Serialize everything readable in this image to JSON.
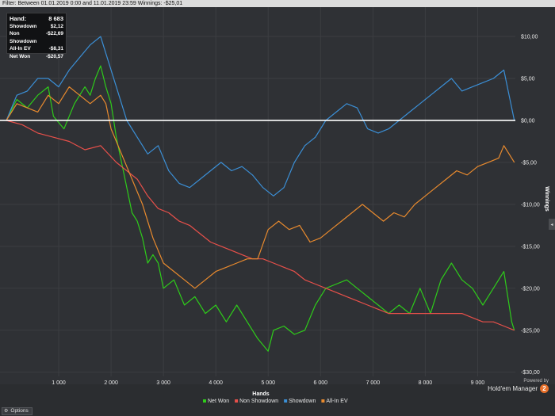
{
  "filter_bar": {
    "text": "Filter: Between 01.01.2019 0:00 and 11.01.2019 23:59 Winnings: -$25,01"
  },
  "stats": [
    {
      "label": "Hand:",
      "value": "8 683"
    },
    {
      "label": "Showdown",
      "value": "$2,12"
    },
    {
      "label": "Non Showdown",
      "value": "-$22,69"
    },
    {
      "label": "All-In EV",
      "value": "-$8,31"
    },
    {
      "label": "Net Won",
      "value": "-$20,57"
    }
  ],
  "options_label": "Options",
  "branding": {
    "powered": "Powered by",
    "product": "Hold'em Manager",
    "badge": "2"
  },
  "colors": {
    "net_won": "#2ecc1a",
    "non_showdown": "#e8504a",
    "showdown": "#3b8fd6",
    "all_in_ev": "#e88a2e",
    "zero_line": "#ffffff",
    "grid": "#3c3e42"
  },
  "chart_data": {
    "type": "line",
    "xlabel": "Hands",
    "ylabel": "Winnings",
    "xlim": [
      0,
      9720
    ],
    "ylim": [
      -30.5,
      13.5
    ],
    "x_ticks": [
      1000,
      2000,
      3000,
      4000,
      5000,
      6000,
      7000,
      8000,
      9000
    ],
    "x_tick_labels": [
      "1 000",
      "2 000",
      "3 000",
      "4 000",
      "5 000",
      "6 000",
      "7 000",
      "8 000",
      "9 000"
    ],
    "y_ticks": [
      10,
      5,
      0,
      -5,
      -10,
      -15,
      -20,
      -25,
      -30
    ],
    "y_tick_labels": [
      "$10,00",
      "$5,00",
      "$0,00",
      "-$5,00",
      "-$10,00",
      "-$15,00",
      "-$20,00",
      "-$25,00",
      "-$30,00"
    ],
    "legend_position": "bottom-center",
    "series": [
      {
        "name": "Net Won",
        "color_key": "net_won",
        "points": [
          [
            0,
            0
          ],
          [
            200,
            2.5
          ],
          [
            400,
            1.5
          ],
          [
            600,
            3
          ],
          [
            800,
            4
          ],
          [
            900,
            0.5
          ],
          [
            1100,
            -1
          ],
          [
            1300,
            2
          ],
          [
            1500,
            4
          ],
          [
            1600,
            3
          ],
          [
            1700,
            5
          ],
          [
            1800,
            6.5
          ],
          [
            1900,
            4
          ],
          [
            2000,
            2
          ],
          [
            2100,
            -2
          ],
          [
            2200,
            -5
          ],
          [
            2300,
            -8
          ],
          [
            2400,
            -11
          ],
          [
            2500,
            -12
          ],
          [
            2600,
            -14
          ],
          [
            2700,
            -17
          ],
          [
            2800,
            -16
          ],
          [
            2900,
            -17
          ],
          [
            3000,
            -20
          ],
          [
            3200,
            -19
          ],
          [
            3400,
            -22
          ],
          [
            3600,
            -21
          ],
          [
            3800,
            -23
          ],
          [
            4000,
            -22
          ],
          [
            4200,
            -24
          ],
          [
            4400,
            -22
          ],
          [
            4600,
            -24
          ],
          [
            4800,
            -26
          ],
          [
            5000,
            -27.5
          ],
          [
            5100,
            -25
          ],
          [
            5300,
            -24.5
          ],
          [
            5500,
            -25.5
          ],
          [
            5700,
            -25
          ],
          [
            5900,
            -22
          ],
          [
            6100,
            -20
          ],
          [
            6300,
            -19.5
          ],
          [
            6500,
            -19
          ],
          [
            6700,
            -20
          ],
          [
            6900,
            -21
          ],
          [
            7100,
            -22
          ],
          [
            7300,
            -23
          ],
          [
            7500,
            -22
          ],
          [
            7700,
            -23
          ],
          [
            7900,
            -20
          ],
          [
            8100,
            -23
          ],
          [
            8300,
            -19
          ],
          [
            8500,
            -17
          ],
          [
            8700,
            -19
          ],
          [
            8900,
            -20
          ],
          [
            9100,
            -22
          ],
          [
            9300,
            -20
          ],
          [
            9500,
            -18
          ],
          [
            9650,
            -24
          ],
          [
            9700,
            -25
          ]
        ]
      },
      {
        "name": "Non Showdown",
        "color_key": "non_showdown",
        "points": [
          [
            0,
            0
          ],
          [
            300,
            -0.5
          ],
          [
            600,
            -1.5
          ],
          [
            900,
            -2
          ],
          [
            1200,
            -2.5
          ],
          [
            1500,
            -3.5
          ],
          [
            1800,
            -3
          ],
          [
            2100,
            -5
          ],
          [
            2300,
            -6
          ],
          [
            2500,
            -7
          ],
          [
            2700,
            -9
          ],
          [
            2900,
            -10.5
          ],
          [
            3100,
            -11
          ],
          [
            3300,
            -12
          ],
          [
            3500,
            -12.5
          ],
          [
            3700,
            -13.5
          ],
          [
            3900,
            -14.5
          ],
          [
            4100,
            -15
          ],
          [
            4300,
            -15.5
          ],
          [
            4500,
            -16
          ],
          [
            4700,
            -16.5
          ],
          [
            4900,
            -16.5
          ],
          [
            5100,
            -17
          ],
          [
            5300,
            -17.5
          ],
          [
            5500,
            -18
          ],
          [
            5700,
            -19
          ],
          [
            5900,
            -19.5
          ],
          [
            6100,
            -20
          ],
          [
            6300,
            -20.5
          ],
          [
            6500,
            -21
          ],
          [
            6700,
            -21.5
          ],
          [
            6900,
            -22
          ],
          [
            7100,
            -22.5
          ],
          [
            7300,
            -23
          ],
          [
            7500,
            -23
          ],
          [
            7700,
            -23
          ],
          [
            7900,
            -23
          ],
          [
            8100,
            -23
          ],
          [
            8300,
            -23
          ],
          [
            8500,
            -23
          ],
          [
            8700,
            -23
          ],
          [
            8900,
            -23.5
          ],
          [
            9100,
            -24
          ],
          [
            9300,
            -24
          ],
          [
            9500,
            -24.5
          ],
          [
            9700,
            -25
          ]
        ]
      },
      {
        "name": "Showdown",
        "color_key": "showdown",
        "points": [
          [
            0,
            0
          ],
          [
            200,
            3
          ],
          [
            400,
            3.5
          ],
          [
            600,
            5
          ],
          [
            800,
            5
          ],
          [
            1000,
            4
          ],
          [
            1200,
            6
          ],
          [
            1400,
            7.5
          ],
          [
            1600,
            9
          ],
          [
            1800,
            10
          ],
          [
            1900,
            8
          ],
          [
            2000,
            6
          ],
          [
            2100,
            4
          ],
          [
            2300,
            0
          ],
          [
            2500,
            -2
          ],
          [
            2700,
            -4
          ],
          [
            2900,
            -3
          ],
          [
            3100,
            -6
          ],
          [
            3300,
            -7.5
          ],
          [
            3500,
            -8
          ],
          [
            3700,
            -7
          ],
          [
            3900,
            -6
          ],
          [
            4100,
            -5
          ],
          [
            4300,
            -6
          ],
          [
            4500,
            -5.5
          ],
          [
            4700,
            -6.5
          ],
          [
            4900,
            -8
          ],
          [
            5100,
            -9
          ],
          [
            5300,
            -8
          ],
          [
            5500,
            -5
          ],
          [
            5700,
            -3
          ],
          [
            5900,
            -2
          ],
          [
            6100,
            0
          ],
          [
            6300,
            1
          ],
          [
            6500,
            2
          ],
          [
            6700,
            1.5
          ],
          [
            6900,
            -1
          ],
          [
            7100,
            -1.5
          ],
          [
            7300,
            -1
          ],
          [
            7500,
            0
          ],
          [
            7700,
            1
          ],
          [
            7900,
            2
          ],
          [
            8100,
            3
          ],
          [
            8300,
            4
          ],
          [
            8500,
            5
          ],
          [
            8700,
            3.5
          ],
          [
            8900,
            4
          ],
          [
            9100,
            4.5
          ],
          [
            9300,
            5
          ],
          [
            9500,
            6
          ],
          [
            9600,
            3
          ],
          [
            9700,
            0
          ]
        ]
      },
      {
        "name": "All-In EV",
        "color_key": "all_in_ev",
        "points": [
          [
            0,
            0
          ],
          [
            200,
            2
          ],
          [
            400,
            1.5
          ],
          [
            600,
            1
          ],
          [
            800,
            3
          ],
          [
            1000,
            2
          ],
          [
            1200,
            4
          ],
          [
            1400,
            3
          ],
          [
            1600,
            2
          ],
          [
            1800,
            3
          ],
          [
            1900,
            2
          ],
          [
            2000,
            -1
          ],
          [
            2200,
            -4
          ],
          [
            2400,
            -7
          ],
          [
            2600,
            -10
          ],
          [
            2800,
            -14
          ],
          [
            3000,
            -17
          ],
          [
            3200,
            -18
          ],
          [
            3400,
            -19
          ],
          [
            3600,
            -20
          ],
          [
            3800,
            -19
          ],
          [
            4000,
            -18
          ],
          [
            4200,
            -17.5
          ],
          [
            4400,
            -17
          ],
          [
            4600,
            -16.5
          ],
          [
            4800,
            -16.5
          ],
          [
            5000,
            -13
          ],
          [
            5200,
            -12
          ],
          [
            5400,
            -13
          ],
          [
            5600,
            -12.5
          ],
          [
            5800,
            -14.5
          ],
          [
            6000,
            -14
          ],
          [
            6200,
            -13
          ],
          [
            6400,
            -12
          ],
          [
            6600,
            -11
          ],
          [
            6800,
            -10
          ],
          [
            7000,
            -11
          ],
          [
            7200,
            -12
          ],
          [
            7400,
            -11
          ],
          [
            7600,
            -11.5
          ],
          [
            7800,
            -10
          ],
          [
            8000,
            -9
          ],
          [
            8200,
            -8
          ],
          [
            8400,
            -7
          ],
          [
            8600,
            -6
          ],
          [
            8800,
            -6.5
          ],
          [
            9000,
            -5.5
          ],
          [
            9200,
            -5
          ],
          [
            9400,
            -4.5
          ],
          [
            9500,
            -3
          ],
          [
            9600,
            -4
          ],
          [
            9700,
            -5
          ]
        ]
      }
    ]
  }
}
